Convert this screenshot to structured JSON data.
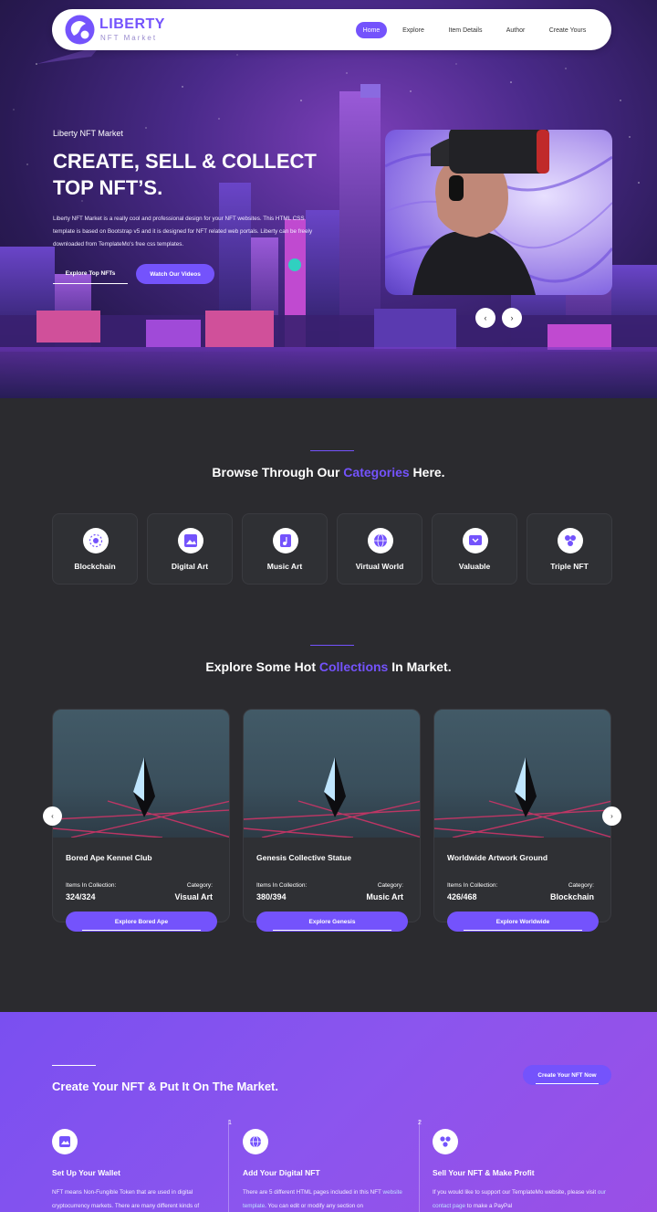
{
  "nav": {
    "brand": "LIBERTY",
    "brand_sub": "NFT Market",
    "items": [
      {
        "label": "Home",
        "active": true
      },
      {
        "label": "Explore",
        "active": false
      },
      {
        "label": "Item Details",
        "active": false
      },
      {
        "label": "Author",
        "active": false
      },
      {
        "label": "Create Yours",
        "active": false
      }
    ]
  },
  "hero": {
    "kicker": "Liberty NFT Market",
    "title_line1": "CREATE, SELL & COLLECT",
    "title_line2": "TOP NFT’S.",
    "description": "Liberty NFT Market is a really cool and professional design for your NFT websites. This HTML CSS template is based on Bootstrap v5 and it is designed for NFT related web portals. Liberty can be freely downloaded from TemplateMo's free css templates.",
    "btn_primary": "Explore Top NFTs",
    "btn_secondary": "Watch Our Videos",
    "prev_icon": "‹",
    "next_icon": "›"
  },
  "categories": {
    "title_pre": "Browse Through Our ",
    "title_accent": "Categories",
    "title_post": " Here.",
    "items": [
      {
        "label": "Blockchain",
        "icon": "blockchain-icon"
      },
      {
        "label": "Digital Art",
        "icon": "digital-art-icon"
      },
      {
        "label": "Music Art",
        "icon": "music-art-icon"
      },
      {
        "label": "Virtual World",
        "icon": "globe-icon"
      },
      {
        "label": "Valuable",
        "icon": "valuable-icon"
      },
      {
        "label": "Triple NFT",
        "icon": "triple-nft-icon"
      }
    ]
  },
  "collections": {
    "title_pre": "Explore Some Hot ",
    "title_accent": "Collections",
    "title_post": " In Market.",
    "prev_icon": "‹",
    "next_icon": "›",
    "items": [
      {
        "name": "Bored Ape Kennel Club",
        "items_label": "Items In Collection:",
        "items_value": "324/324",
        "category_label": "Category:",
        "category_value": "Visual Art",
        "button": "Explore Bored Ape"
      },
      {
        "name": "Genesis Collective Statue",
        "items_label": "Items In Collection:",
        "items_value": "380/394",
        "category_label": "Category:",
        "category_value": "Music Art",
        "button": "Explore Genesis"
      },
      {
        "name": "Worldwide Artwork Ground",
        "items_label": "Items In Collection:",
        "items_value": "426/468",
        "category_label": "Category:",
        "category_value": "Blockchain",
        "button": "Explore Worldwide"
      }
    ]
  },
  "create": {
    "title": "Create Your NFT & Put It On The Market.",
    "button": "Create Your NFT Now",
    "steps": [
      {
        "title": "Set Up Your Wallet",
        "desc": "NFT means Non-Fungible Token that are used in digital cryptocurrency markets. There are many different kinds of",
        "num": ""
      },
      {
        "title": "Add Your Digital NFT",
        "desc_pre": "There are 5 different HTML pages included in this NFT ",
        "desc_link": "website template",
        "desc_post": ". You can edit or modify any section on",
        "num": "1"
      },
      {
        "title": "Sell Your NFT & Make Profit",
        "desc_pre": "If you would like to support our TemplateMo website, please visit ",
        "desc_link": "our contact page",
        "desc_post": " to make a PayPal",
        "num": "2"
      }
    ]
  },
  "colors": {
    "accent": "#7453fc",
    "dark_bg": "#2b2b2f",
    "card_bg": "#2f3034"
  }
}
